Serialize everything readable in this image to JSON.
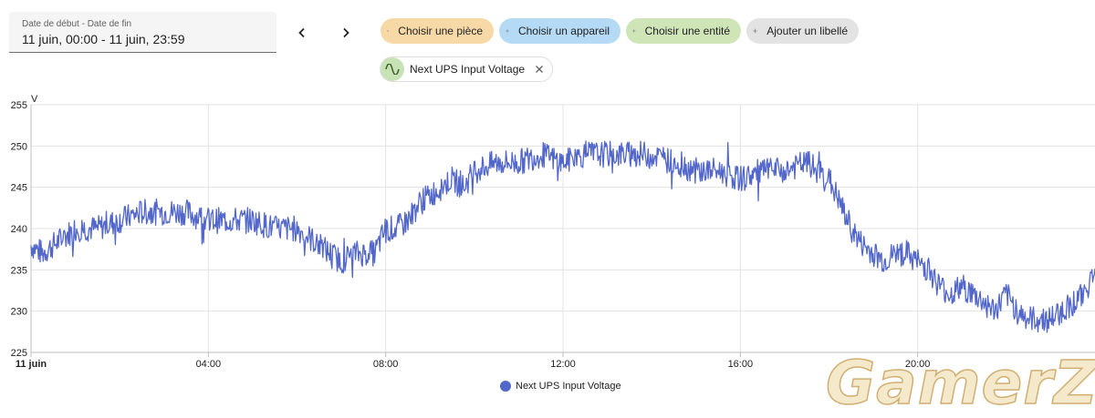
{
  "date_range": {
    "label": "Date de début - Date de fin",
    "value": "11 juin, 00:00 - 11 juin, 23:59"
  },
  "nav": {
    "prev_icon": "chevron-left-icon",
    "next_icon": "chevron-right-icon"
  },
  "target_chips": [
    {
      "label": "Choisir une pièce",
      "color": "#f6d9a6"
    },
    {
      "label": "Choisir un appareil",
      "color": "#b5daf6"
    },
    {
      "label": "Choisir une entité",
      "color": "#cfe5b8"
    },
    {
      "label": "Ajouter un libellé",
      "color": "#e3e3e3"
    }
  ],
  "entity_chip": {
    "label": "Next UPS Input Voltage",
    "icon": "sine-wave-icon"
  },
  "watermark": "GamerZ",
  "chart_data": {
    "type": "line",
    "ylabel": "V",
    "ylim": [
      225,
      255
    ],
    "yticks": [
      "255",
      "250",
      "245",
      "240",
      "235",
      "230",
      "225"
    ],
    "x_hours_range": [
      0,
      24
    ],
    "xticks": [
      {
        "label": "11 juin",
        "hour": 0,
        "bold": true
      },
      {
        "label": "04:00",
        "hour": 4
      },
      {
        "label": "08:00",
        "hour": 8
      },
      {
        "label": "12:00",
        "hour": 12
      },
      {
        "label": "16:00",
        "hour": 16
      },
      {
        "label": "20:00",
        "hour": 20
      }
    ],
    "grid": true,
    "series": [
      {
        "name": "Next UPS Input Voltage",
        "color": "#5267c9",
        "x_hours": [
          0,
          0.25,
          0.5,
          0.75,
          1,
          1.5,
          2,
          2.5,
          3,
          3.5,
          4,
          4.5,
          5,
          5.5,
          6,
          6.25,
          6.5,
          6.75,
          7,
          7.25,
          7.5,
          7.75,
          8,
          8.25,
          8.5,
          8.75,
          9,
          9.25,
          9.5,
          9.75,
          10,
          10.5,
          11,
          11.5,
          12,
          12.5,
          13,
          13.5,
          14,
          14.5,
          15,
          15.5,
          16,
          16.5,
          17,
          17.5,
          18,
          18.25,
          18.5,
          18.75,
          19,
          19.25,
          19.5,
          19.75,
          20,
          20.25,
          20.5,
          20.75,
          21,
          21.25,
          21.5,
          21.75,
          22,
          22.25,
          22.5,
          22.75,
          23,
          23.25,
          23.5,
          23.75,
          24
        ],
        "values": [
          238,
          237,
          238,
          239,
          240,
          240,
          241,
          242,
          242,
          242,
          241,
          241,
          241,
          240,
          240,
          239,
          238,
          237,
          236,
          237,
          237,
          237,
          240,
          240,
          241,
          243,
          244,
          245,
          246,
          245,
          247,
          248,
          248,
          249,
          248,
          249,
          249,
          249,
          249,
          248,
          247,
          247,
          246,
          247,
          247,
          248,
          246,
          243,
          240,
          238,
          237,
          236,
          237,
          237,
          236,
          235,
          233,
          232,
          233,
          232,
          231,
          230,
          232,
          230,
          229,
          229,
          229,
          230,
          231,
          232,
          235
        ]
      }
    ]
  }
}
